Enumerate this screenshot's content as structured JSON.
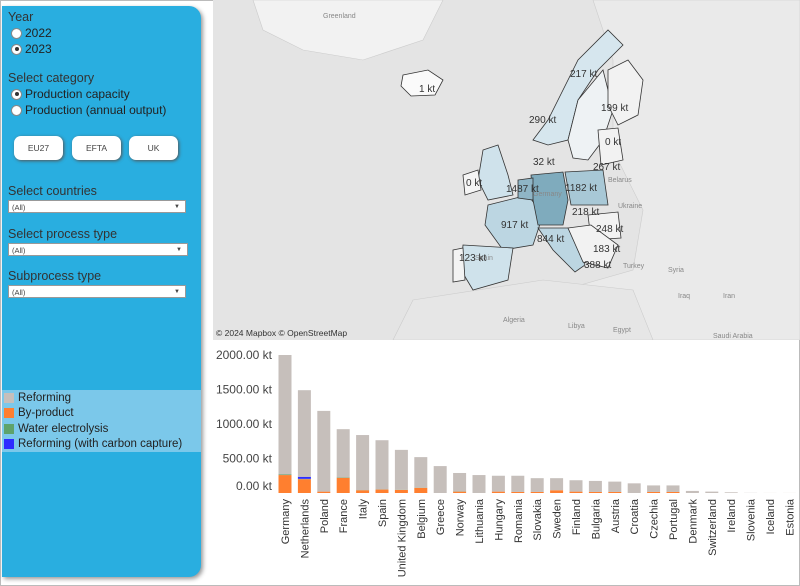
{
  "sidebar": {
    "year_label": "Year",
    "years": [
      {
        "label": "2022",
        "selected": false
      },
      {
        "label": "2023",
        "selected": true
      }
    ],
    "category_label": "Select category",
    "categories": [
      {
        "label": "Production capacity",
        "selected": true
      },
      {
        "label": "Production (annual output)",
        "selected": false
      }
    ],
    "buttons": [
      "EU27",
      "EFTA",
      "UK"
    ],
    "countries_label": "Select countries",
    "countries_value": "(All)",
    "process_label": "Select process type",
    "process_value": "(All)",
    "subprocess_label": "Subprocess type",
    "subprocess_value": "(All)",
    "legend": [
      {
        "label": "Reforming",
        "color": "#c6bfbb"
      },
      {
        "label": "By-product",
        "color": "#ff7f2f"
      },
      {
        "label": "Water electrolysis",
        "color": "#5ea36b"
      },
      {
        "label": "Reforming (with carbon capture)",
        "color": "#2d2dff"
      }
    ]
  },
  "map": {
    "attribution": "© 2024 Mapbox  © OpenStreetMap",
    "place_labels": [
      "Greenland",
      "Belarus",
      "Ukraine",
      "Turkey",
      "Iraq",
      "Iran",
      "Syria",
      "Algeria",
      "Libya",
      "Egypt",
      "Saudi Arabia",
      "Germany",
      "Spain"
    ],
    "value_labels": [
      {
        "country": "Iceland",
        "label": "1 kt"
      },
      {
        "country": "Sweden",
        "label": "217 kt"
      },
      {
        "country": "Finland",
        "label": "199 kt"
      },
      {
        "country": "Norway",
        "label": "290 kt"
      },
      {
        "country": "Estonia",
        "label": "0 kt"
      },
      {
        "country": "Denmark",
        "label": "32 kt"
      },
      {
        "country": "Lithuania",
        "label": "267 kt"
      },
      {
        "country": "Ireland",
        "label": "0 kt"
      },
      {
        "country": "Netherlands",
        "label": "1487 kt"
      },
      {
        "country": "Poland",
        "label": "1182 kt"
      },
      {
        "country": "Slovakia",
        "label": "218 kt"
      },
      {
        "country": "France",
        "label": "917 kt"
      },
      {
        "country": "Romania",
        "label": "248 kt"
      },
      {
        "country": "Italy",
        "label": "844 kt"
      },
      {
        "country": "Bulgaria",
        "label": "183 kt"
      },
      {
        "country": "Portugal",
        "label": "123 kt"
      },
      {
        "country": "Greece",
        "label": "388 kt"
      }
    ]
  },
  "chart_data": {
    "type": "bar",
    "stacked": true,
    "ylim": [
      0,
      2000
    ],
    "yticks": [
      "0.00 kt",
      "500.00 kt",
      "1000.00 kt",
      "1500.00 kt",
      "2000.00 kt"
    ],
    "categories": [
      "Germany",
      "Netherlands",
      "Poland",
      "France",
      "Italy",
      "Spain",
      "United Kingdom",
      "Belgium",
      "Greece",
      "Norway",
      "Lithuania",
      "Hungary",
      "Romania",
      "Slovakia",
      "Sweden",
      "Finland",
      "Bulgaria",
      "Austria",
      "Croatia",
      "Czechia",
      "Portugal",
      "Denmark",
      "Switzerland",
      "Ireland",
      "Slovenia",
      "Iceland",
      "Estonia"
    ],
    "series": [
      {
        "name": "By-product",
        "values": [
          260,
          200,
          20,
          220,
          40,
          50,
          45,
          75,
          0,
          20,
          0,
          20,
          15,
          15,
          40,
          20,
          15,
          15,
          0,
          15,
          15,
          0,
          0,
          0,
          0,
          0,
          0
        ]
      },
      {
        "name": "Water electrolysis",
        "values": [
          8,
          5,
          0,
          5,
          2,
          2,
          2,
          2,
          0,
          2,
          0,
          0,
          0,
          0,
          0,
          0,
          0,
          0,
          0,
          0,
          0,
          0,
          0,
          0,
          0,
          0,
          0
        ]
      },
      {
        "name": "Reforming (with carbon capture)",
        "values": [
          0,
          30,
          0,
          0,
          0,
          0,
          0,
          0,
          0,
          0,
          0,
          0,
          0,
          0,
          0,
          0,
          0,
          0,
          0,
          0,
          0,
          0,
          0,
          0,
          0,
          0,
          0
        ]
      },
      {
        "name": "Reforming",
        "values": [
          1732,
          1255,
          1170,
          700,
          798,
          713,
          578,
          443,
          390,
          268,
          260,
          230,
          235,
          200,
          175,
          165,
          160,
          150,
          140,
          95,
          95,
          30,
          20,
          10,
          2,
          1,
          1
        ]
      }
    ]
  }
}
